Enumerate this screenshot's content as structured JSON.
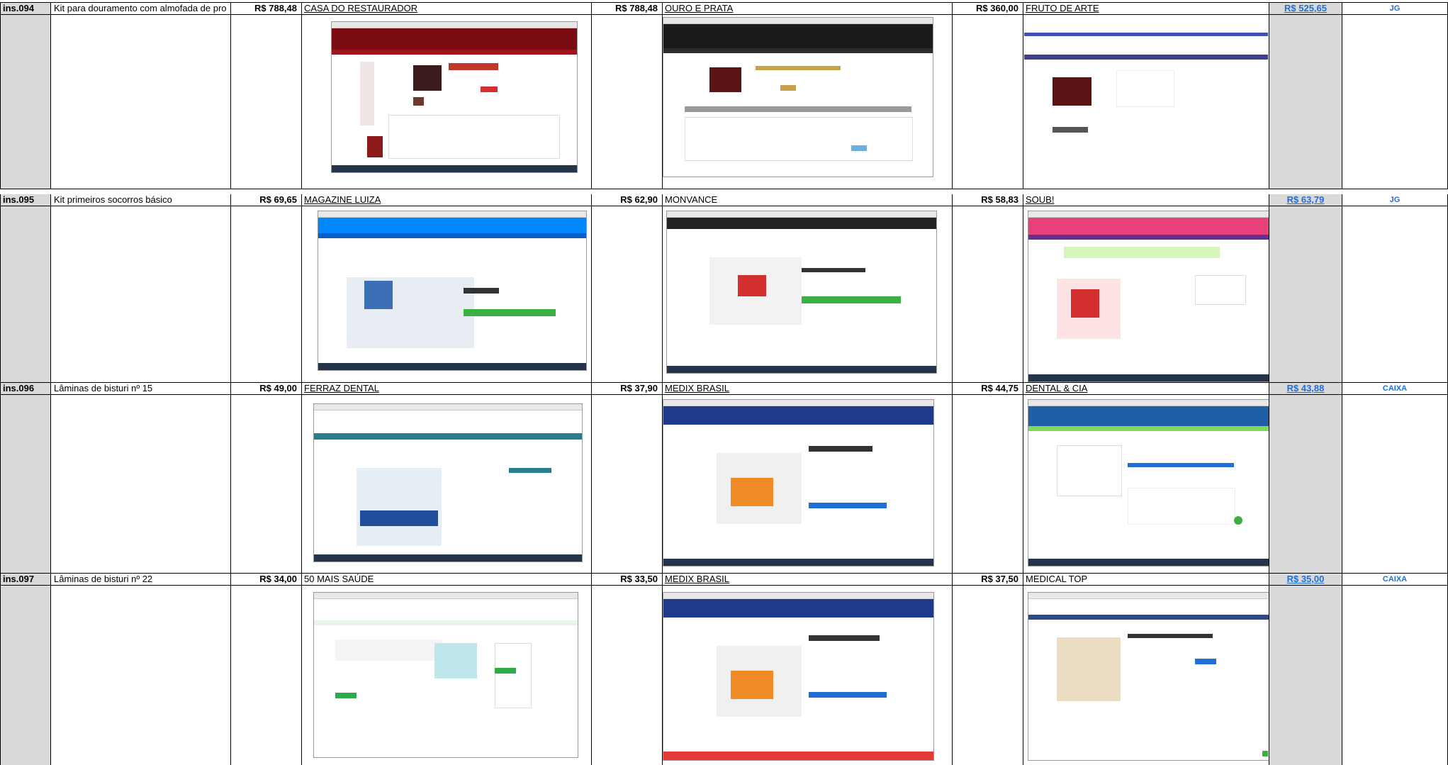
{
  "rows": [
    {
      "id": "ins.094",
      "description": "Kit para douramento com almofada de pro",
      "price1": "R$ 788,48",
      "store1": "CASA DO RESTAURADOR",
      "price2": "R$ 788,48",
      "store2": "OURO E PRATA",
      "price3": "R$ 360,00",
      "store3": "FRUTO DE ARTE",
      "average": "R$ 525,65",
      "unit": "JG"
    },
    {
      "id": "ins.095",
      "description": "Kit primeiros socorros básico",
      "price1": "R$ 69,65",
      "store1": "MAGAZINE LUIZA",
      "price2": "R$ 62,90",
      "store2": "MONVANCE",
      "price3": "R$ 58,83",
      "store3": "SOUB!",
      "average": "R$ 63,79",
      "unit": "JG"
    },
    {
      "id": "ins.096",
      "description": "Lâminas de bisturi nº 15",
      "price1": "R$ 49,00",
      "store1": "FERRAZ DENTAL",
      "price2": "R$ 37,90",
      "store2": "MEDIX BRASIL",
      "price3": "R$ 44,75",
      "store3": "DENTAL & CIA",
      "average": "R$ 43,88",
      "unit": "CAIXA"
    },
    {
      "id": "ins.097",
      "description": "Lâminas de bisturi nº 22",
      "price1": "R$ 34,00",
      "store1": "50 MAIS SAÚDE",
      "price2": "R$ 33,50",
      "store2": "MEDIX BRASIL",
      "price3": "R$ 37,50",
      "store3": "MEDICAL TOP",
      "average": "R$ 35,00",
      "unit": "CAIXA"
    }
  ],
  "colors": {
    "id_background": "#d9d9d9",
    "average_text": "#1f6fd6",
    "grid": "#000000"
  }
}
